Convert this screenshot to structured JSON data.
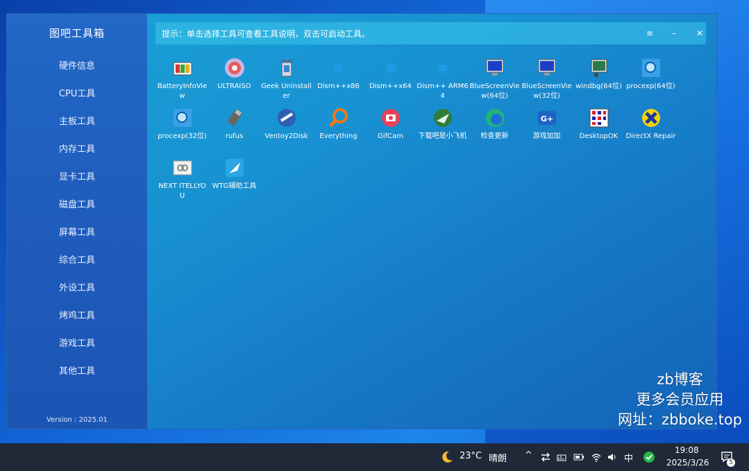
{
  "app": {
    "title": "图吧工具箱",
    "version": "Version : 2025.01"
  },
  "sidebar": {
    "items": [
      {
        "label": "硬件信息"
      },
      {
        "label": "CPU工具"
      },
      {
        "label": "主板工具"
      },
      {
        "label": "内存工具"
      },
      {
        "label": "显卡工具"
      },
      {
        "label": "磁盘工具"
      },
      {
        "label": "屏幕工具"
      },
      {
        "label": "综合工具"
      },
      {
        "label": "外设工具"
      },
      {
        "label": "烤鸡工具"
      },
      {
        "label": "游戏工具"
      },
      {
        "label": "其他工具"
      }
    ]
  },
  "topbar": {
    "hint": "提示：单击选择工具可查看工具说明，双击可启动工具。",
    "menu": "≡",
    "minimize": "–",
    "close": "✕"
  },
  "tools": [
    {
      "label": "BatteryInfoView",
      "icon": "battery-icon"
    },
    {
      "label": "ULTRAISO",
      "icon": "disc-icon"
    },
    {
      "label": "Geek Uninstaller",
      "icon": "trash-icon"
    },
    {
      "label": "Dism++x86",
      "icon": "dism-icon"
    },
    {
      "label": "Dism++x64",
      "icon": "dism-icon"
    },
    {
      "label": "Dism++ ARM64",
      "icon": "dism-icon"
    },
    {
      "label": "BlueScreenView(64位)",
      "icon": "monitor-icon"
    },
    {
      "label": "BlueScreenView(32位)",
      "icon": "monitor-icon"
    },
    {
      "label": "windbg(64位)",
      "icon": "debugger-icon"
    },
    {
      "label": "procexp(64位)",
      "icon": "process-icon"
    },
    {
      "label": "procexp(32位)",
      "icon": "process-icon"
    },
    {
      "label": "rufus",
      "icon": "usb-icon"
    },
    {
      "label": "Ventoy2Disk",
      "icon": "ventoy-icon"
    },
    {
      "label": "Everything",
      "icon": "magnifier-icon"
    },
    {
      "label": "GifCam",
      "icon": "camera-icon"
    },
    {
      "label": "下载吧是小飞机",
      "icon": "plane-icon"
    },
    {
      "label": "检查更新",
      "icon": "edge-icon"
    },
    {
      "label": "游戏加加",
      "icon": "game-icon"
    },
    {
      "label": "DesktopOK",
      "icon": "desktop-grid-icon"
    },
    {
      "label": "DirectX Repair",
      "icon": "directx-icon"
    },
    {
      "label": "NEXT ITELLYOU",
      "icon": "link-icon"
    },
    {
      "label": "WTG辅助工具",
      "icon": "wtg-icon"
    }
  ],
  "watermark": {
    "line1": "zb博客",
    "line2": "更多会员应用",
    "line3": "网址：zbboke.top"
  },
  "taskbar": {
    "weather_temp": "23°C",
    "weather_desc": "晴朗",
    "ime": "中",
    "time": "19:08",
    "date": "2025/3/26",
    "notif_count": "5"
  }
}
